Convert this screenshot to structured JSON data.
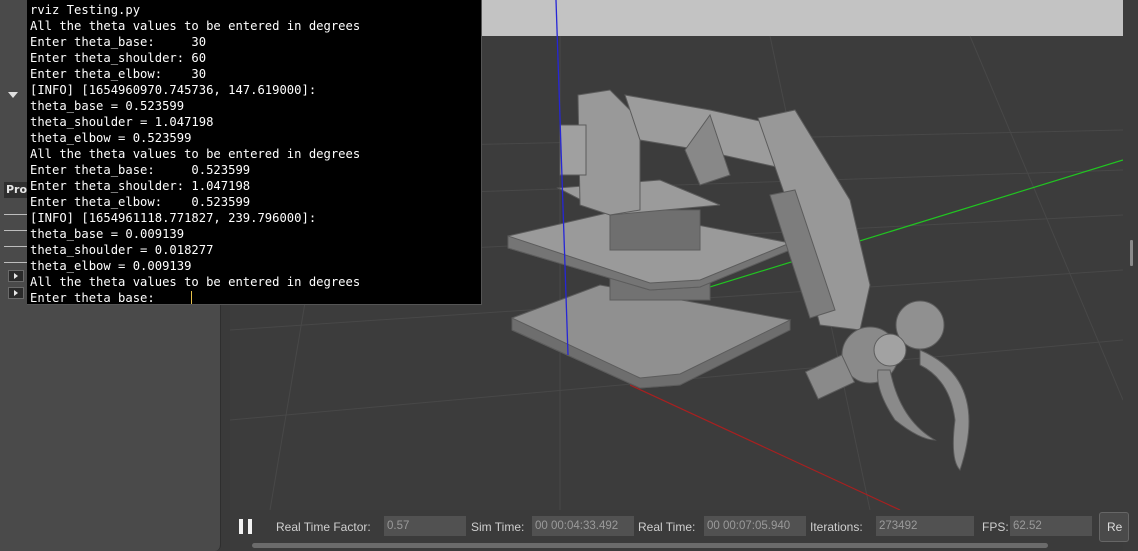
{
  "terminal": {
    "lines": [
      "rviz Testing.py",
      "All the theta values to be entered in degrees",
      "Enter theta_base:     30",
      "Enter theta_shoulder: 60",
      "Enter theta_elbow:    30",
      "[INFO] [1654960970.745736, 147.619000]:",
      "theta_base = 0.523599",
      "theta_shoulder = 1.047198",
      "theta_elbow = 0.523599",
      "All the theta values to be entered in degrees",
      "Enter theta_base:     0.523599",
      "Enter theta_shoulder: 1.047198",
      "Enter theta_elbow:    0.523599",
      "[INFO] [1654961118.771827, 239.796000]:",
      "theta_base = 0.009139",
      "theta_shoulder = 0.018277",
      "theta_elbow = 0.009139",
      "All the theta values to be entered in degrees",
      "Enter theta_base:     "
    ]
  },
  "left_panel": {
    "props_header": "Pro"
  },
  "status_bar": {
    "real_time_factor_label": "Real Time Factor:",
    "real_time_factor_value": "0.57",
    "sim_time_label": "Sim Time:",
    "sim_time_value": "00 00:04:33.492",
    "real_time_label": "Real Time:",
    "real_time_value": "00 00:07:05.940",
    "iterations_label": "Iterations:",
    "iterations_value": "273492",
    "fps_label": "FPS:",
    "fps_value": "62.52",
    "reset_label": "Re"
  },
  "colors": {
    "axis_x": "#b02020",
    "axis_y": "#20c020",
    "axis_z": "#2a2ad8",
    "robot_gray": "#8c8c8c",
    "terminal_bg": "#000000",
    "terminal_fg": "#ffffff",
    "cursor": "#e6c04a"
  },
  "icons": {
    "pause": "pause-icon",
    "expand": "triangle-down-icon",
    "tree_expander": "triangle-right-icon"
  }
}
